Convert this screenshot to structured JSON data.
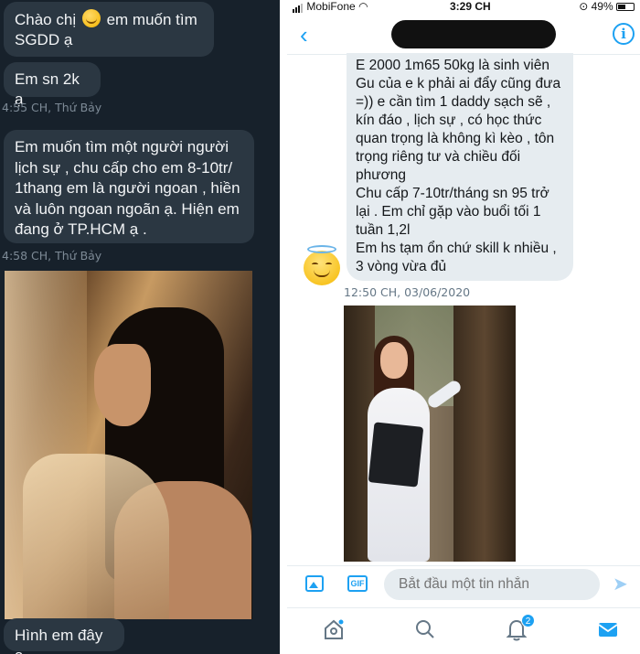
{
  "left_chat": {
    "messages": [
      {
        "text_before": "Chào chị",
        "emoji": "smiling-face-with-hearts",
        "text_after": " em muốn tìm",
        "line2": "SGDD ạ"
      },
      {
        "text": "Em sn 2k ạ"
      }
    ],
    "timestamp_1": "4:55 CH, Thứ Bảy",
    "long_message_lines": [
      "Em muốn tìm một người người",
      "lịch sự , chu cấp cho em 8-10tr/",
      "1thang em là người ngoan , hiền",
      "và luôn ngoan ngoãn ạ. Hiện em",
      "đang ở TP.HCM ạ ."
    ],
    "timestamp_2": "4:58 CH, Thứ Bảy",
    "last_message": "Hình em đây ạ"
  },
  "phone": {
    "status_bar": {
      "carrier": "MobiFone",
      "time": "3:29 CH",
      "battery": "49%"
    },
    "icons": {
      "back": "back-arrow-icon",
      "info": "info-icon",
      "image": "image-icon",
      "gif": "gif-icon",
      "send": "send-icon",
      "home": "home-icon",
      "search": "search-icon",
      "notifications": "bell-icon",
      "messages": "mail-icon"
    },
    "message_lines": [
      "E 2000 1m65 50kg là sinh viên",
      "Gu của e k phải ai đẩy cũng đưa",
      "=)) e cần tìm 1 daddy sạch sẽ ,",
      "kín đáo , lịch sự , có học thức",
      "quan trọng là không kì kèo , tôn",
      "trọng riêng tư và chiều đối",
      "phương",
      "Chu cấp 7-10tr/tháng sn 95 trở",
      "lại . Em chỉ gặp vào buổi tối 1",
      "tuần 1,2l",
      "Em hs tạm ổn chứ skill k nhiều ,",
      "3 vòng vừa đủ"
    ],
    "timestamp": "12:50 CH, 03/06/2020",
    "composer": {
      "placeholder": "Bắt đầu một tin nhắn"
    },
    "notification_badge": "2",
    "colors": {
      "accent": "#1da1f2",
      "bubble": "#e6ecf0",
      "dark_bg": "#17212b",
      "dark_bubble": "#2b3742"
    }
  }
}
